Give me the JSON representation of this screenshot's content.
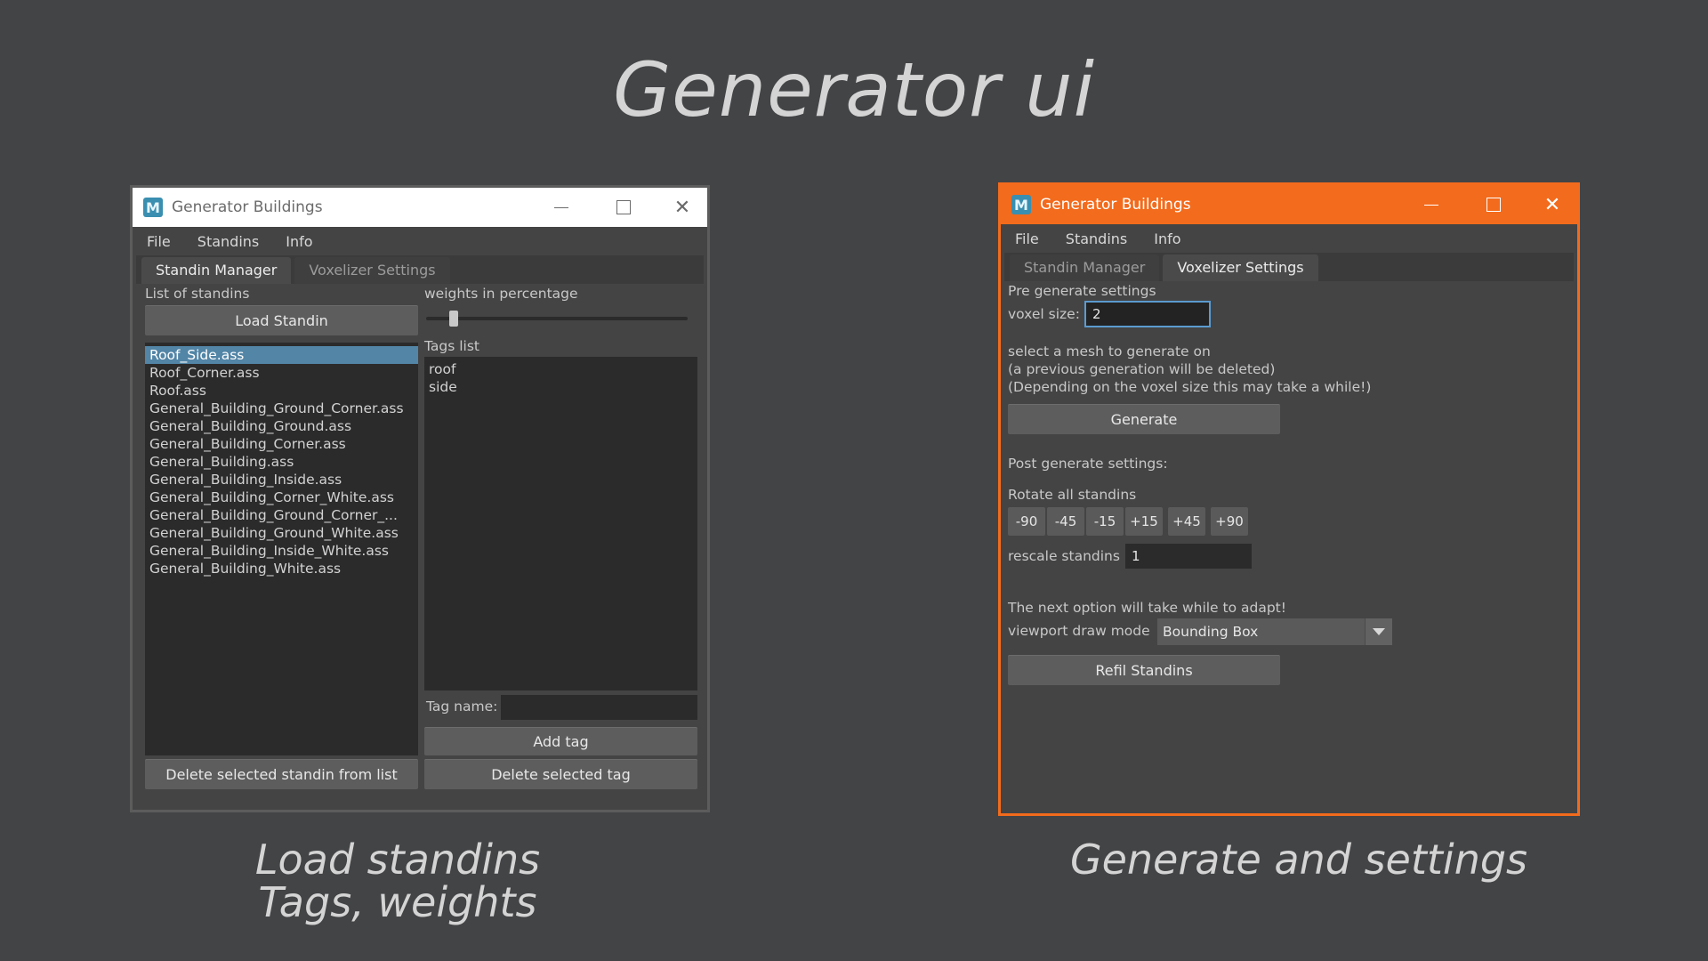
{
  "slide": {
    "title": "Generator ui",
    "caption_left_line1": "Load standins",
    "caption_left_line2": "Tags, weights",
    "caption_right": "Generate and settings"
  },
  "windows": [
    {
      "title": "Generator Buildings",
      "app_icon": "M",
      "menu": [
        "File",
        "Standins",
        "Info"
      ],
      "tabs": [
        "Standin Manager",
        "Voxelizer Settings"
      ],
      "active_tab": "Standin Manager",
      "standin_manager": {
        "list_label": "List of standins",
        "load_button": "Load Standin",
        "standins": [
          "Roof_Side.ass",
          "Roof_Corner.ass",
          "Roof.ass",
          "General_Building_Ground_Corner.ass",
          "General_Building_Ground.ass",
          "General_Building_Corner.ass",
          "General_Building.ass",
          "General_Building_Inside.ass",
          "General_Building_Corner_White.ass",
          "General_Building_Ground_Corner_...",
          "General_Building_Ground_White.ass",
          "General_Building_Inside_White.ass",
          "General_Building_White.ass"
        ],
        "selected_standin": "Roof_Side.ass",
        "weights_label": "weights in percentage",
        "weight_value": 0.09,
        "tags_label": "Tags list",
        "tags": [
          "roof",
          "side"
        ],
        "tag_name_label": "Tag name:",
        "tag_name_value": "",
        "add_tag_button": "Add tag",
        "delete_standin_button": "Delete selected standin from list",
        "delete_tag_button": "Delete selected tag"
      }
    },
    {
      "title": "Generator Buildings",
      "app_icon": "M",
      "menu": [
        "File",
        "Standins",
        "Info"
      ],
      "tabs": [
        "Standin Manager",
        "Voxelizer Settings"
      ],
      "active_tab": "Voxelizer Settings",
      "voxelizer": {
        "pre_label": "Pre generate settings",
        "voxel_label": "voxel size:",
        "voxel_value": "2",
        "info_line1": "select a mesh to generate on",
        "info_line2": "(a previous generation will be deleted)",
        "info_line3": "(Depending on the voxel size this may take a while!)",
        "generate_button": "Generate",
        "post_label": "Post generate settings:",
        "rotate_label": "Rotate all standins",
        "rotate_buttons": [
          "-90",
          "-45",
          "-15",
          "+15",
          "+45",
          "+90"
        ],
        "rescale_label": "rescale standins",
        "rescale_value": "1",
        "next_option_text": "The next option will take while to adapt!",
        "draw_mode_label": "viewport draw mode",
        "draw_mode_value": "Bounding Box",
        "refill_button": "Refil Standins"
      }
    }
  ],
  "colors": {
    "background": "#434446",
    "active_window_accent": "#f36b1c",
    "selection": "#5285a6",
    "focus_border": "#5b9bd0"
  }
}
